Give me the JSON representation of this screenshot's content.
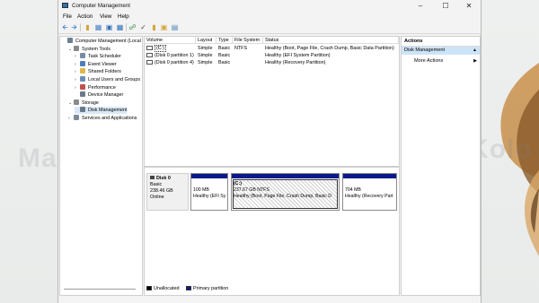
{
  "window": {
    "title": "Computer Management"
  },
  "menu": [
    "File",
    "Action",
    "View",
    "Help"
  ],
  "tree": [
    {
      "label": "Computer Management (Local",
      "indent": 0,
      "expander": "",
      "icon_color": "#6b7f95"
    },
    {
      "label": "System Tools",
      "indent": 1,
      "expander": "⌄",
      "icon_color": "#8a8a8a"
    },
    {
      "label": "Task Scheduler",
      "indent": 2,
      "expander": "›",
      "icon_color": "#7a8aa0"
    },
    {
      "label": "Event Viewer",
      "indent": 2,
      "expander": "›",
      "icon_color": "#4d7fb8"
    },
    {
      "label": "Shared Folders",
      "indent": 2,
      "expander": "›",
      "icon_color": "#e0b84a"
    },
    {
      "label": "Local Users and Groups",
      "indent": 2,
      "expander": "›",
      "icon_color": "#6d8fb3"
    },
    {
      "label": "Performance",
      "indent": 2,
      "expander": "›",
      "icon_color": "#c0504d"
    },
    {
      "label": "Device Manager",
      "indent": 2,
      "expander": "",
      "icon_color": "#6a7a8a"
    },
    {
      "label": "Storage",
      "indent": 1,
      "expander": "⌄",
      "icon_color": "#8a8a8a"
    },
    {
      "label": "Disk Management",
      "indent": 2,
      "expander": "",
      "icon_color": "#6a7a8a",
      "selected": true
    },
    {
      "label": "Services and Applications",
      "indent": 1,
      "expander": "›",
      "icon_color": "#7a8a9a"
    }
  ],
  "volumes": {
    "columns": [
      "Volume",
      "Layout",
      "Type",
      "File System",
      "Status"
    ],
    "rows": [
      [
        "(C:)",
        "Simple",
        "Basic",
        "NTFS",
        "Healthy (Boot, Page File, Crash Dump, Basic Data Partition)"
      ],
      [
        "(Disk 0 partition 1)",
        "Simple",
        "Basic",
        "",
        "Healthy (EFI System Partition)"
      ],
      [
        "(Disk 0 partition 4)",
        "Simple",
        "Basic",
        "",
        "Healthy (Recovery Partition)"
      ]
    ]
  },
  "disk": {
    "name": "Disk 0",
    "type": "Basic",
    "size": "238.46 GB",
    "state": "Online",
    "partitions": [
      {
        "title": "",
        "size": "100 MB",
        "status": "Healthy (EFI Sy"
      },
      {
        "title": "(C:)",
        "size": "237.67 GB NTFS",
        "status": "Healthy (Boot, Page File, Crash Dump, Basic D"
      },
      {
        "title": "",
        "size": "704 MB",
        "status": "Healthy (Recovery Part"
      }
    ]
  },
  "legend": {
    "unallocated": "Unallocated",
    "primary": "Primary partition"
  },
  "actions": {
    "header": "Actions",
    "section": "Disk Management",
    "more": "More Actions"
  },
  "watermark": "Master Kolo",
  "colors": {
    "primary_partition": "#0a1a8a",
    "selection": "#cde3f7"
  }
}
